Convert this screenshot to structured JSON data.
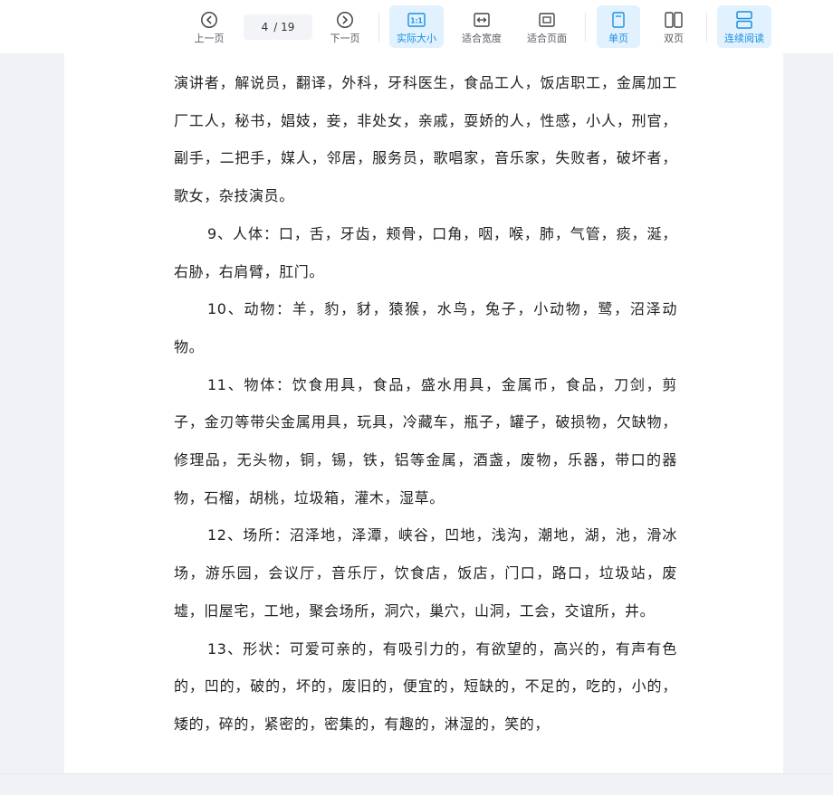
{
  "toolbar": {
    "prev_label": "上一页",
    "next_label": "下一页",
    "current_page": "4",
    "total_pages": "/ 19",
    "actual_size_label": "实际大小",
    "actual_size_icon_text": "1:1",
    "fit_width_label": "适合宽度",
    "fit_page_label": "适合页面",
    "single_page_label": "单页",
    "double_page_label": "双页",
    "continuous_label": "连续阅读",
    "active_color": "#1a8fe3",
    "active_bg": "#e1f1fd",
    "icons": {
      "prev": "chevron-left-circle-icon",
      "next": "chevron-right-circle-icon",
      "actual_size": "actual-size-icon",
      "fit_width": "fit-width-icon",
      "fit_page": "fit-page-icon",
      "single_page": "single-page-icon",
      "double_page": "double-page-icon",
      "continuous": "continuous-read-icon"
    }
  },
  "document": {
    "paragraphs": [
      {
        "indent": false,
        "text": "演讲者，解说员，翻译，外科，牙科医生，食品工人，饭店职工，金属加工厂工人，秘书，娼妓，妾，非处女，亲戚，耍娇的人，性感，小人，刑官，副手，二把手，媒人，邻居，服务员，歌唱家，音乐家，失败者，破坏者，歌女，杂技演员。"
      },
      {
        "indent": true,
        "text": "9、人体：口，舌，牙齿，颊骨，口角，咽，喉，肺，气管，痰，涎，右胁，右肩臂，肛门。"
      },
      {
        "indent": true,
        "text": "10、动物：羊，豹，豺，猿猴，水鸟，兔子，小动物，鹭，沼泽动物。"
      },
      {
        "indent": true,
        "text": "11、物体：饮食用具，食品，盛水用具，金属币，食品，刀剑，剪子，金刃等带尖金属用具，玩具，冷藏车，瓶子，罐子，破损物，欠缺物，修理品，无头物，铜，锡，铁，铝等金属，酒盏，废物，乐器，带口的器物，石榴，胡桃，垃圾箱，灌木，湿草。"
      },
      {
        "indent": true,
        "text": "12、场所：沼泽地，泽潭，峡谷，凹地，浅沟，潮地，湖，池，滑冰场，游乐园，会议厅，音乐厅，饮食店，饭店，门口，路口，垃圾站，废墟，旧屋宅，工地，聚会场所，洞穴，巢穴，山洞，工会，交谊所，井。"
      },
      {
        "indent": true,
        "text": "13、形状：可爱可亲的，有吸引力的，有欲望的，高兴的，有声有色的，凹的，破的，坏的，废旧的，便宜的，短缺的，不足的，吃的，小的，矮的，碎的，紧密的，密集的，有趣的，淋湿的，笑的，"
      }
    ]
  }
}
